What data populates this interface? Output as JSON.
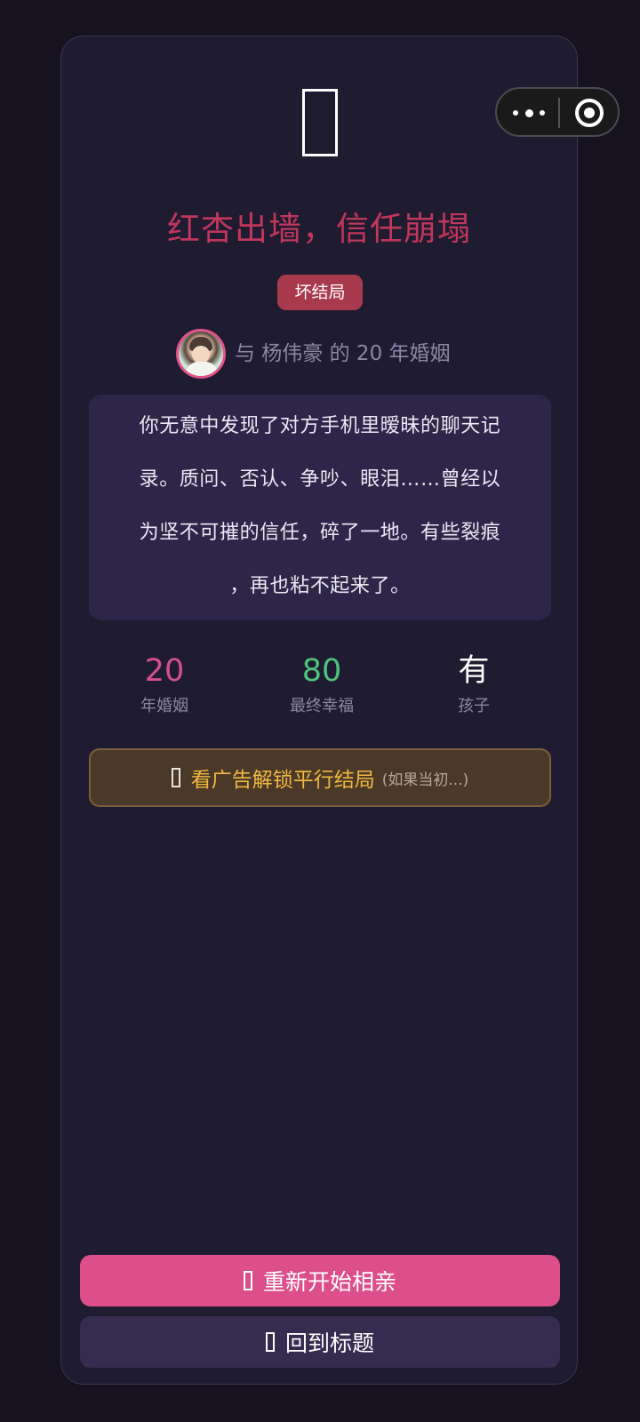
{
  "ending": {
    "title": "红杏出墙，信任崩塌",
    "badge": "坏结局",
    "marriage_text": "与 杨伟豪 的 20 年婚姻",
    "story_lines": [
      "你无意中发现了对方手机里暧昧的聊天记",
      "录。质问、否认、争吵、眼泪……曾经以",
      "为坚不可摧的信任，碎了一地。有些裂痕",
      "，再也粘不起来了。"
    ]
  },
  "stats": [
    {
      "value": "20",
      "label": "年婚姻",
      "color": "#d4508a"
    },
    {
      "value": "80",
      "label": "最终幸福",
      "color": "#4fc27e"
    },
    {
      "value": "有",
      "label": "孩子",
      "color": "#ffffff"
    }
  ],
  "unlock": {
    "label": "看广告解锁平行结局",
    "hint": "(如果当初...)",
    "accent": "#f0b840"
  },
  "buttons": {
    "restart": "重新开始相亲",
    "back_to_title": "回到标题"
  },
  "colors": {
    "title": "#c0365d",
    "badge_bg": "#a93a4e",
    "restart_bg": "#dc4f8a"
  },
  "icons": {
    "ending_emoji": "missing-glyph-icon",
    "capsule_more": "more-dots-icon",
    "capsule_close": "target-close-icon"
  }
}
